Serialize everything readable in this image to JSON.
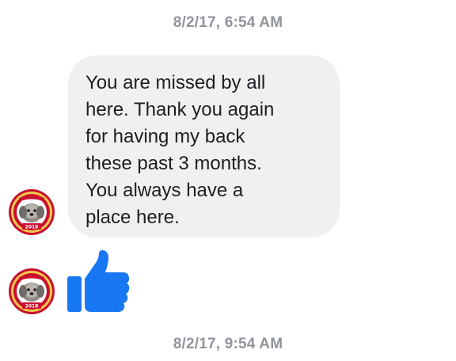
{
  "thread": {
    "timestamp_top": "8/2/17, 6:54 AM",
    "timestamp_bottom": "8/2/17, 9:54 AM",
    "message": {
      "lines": [
        "You are missed by all",
        "here. Thank you again",
        "for having my back",
        "these past 3 months.",
        "You always have a",
        "place here."
      ]
    },
    "avatar": {
      "icon": "dog-portrait-badge",
      "year_text": "2018",
      "banner_text": "HAPPY HOLIDAYS"
    },
    "like_icon": "thumbs-up-icon"
  },
  "colors": {
    "bubble_bg": "#f1f0f0",
    "timestamp": "#90949c",
    "like_blue": "#1877f2",
    "badge_red": "#c8102e"
  }
}
